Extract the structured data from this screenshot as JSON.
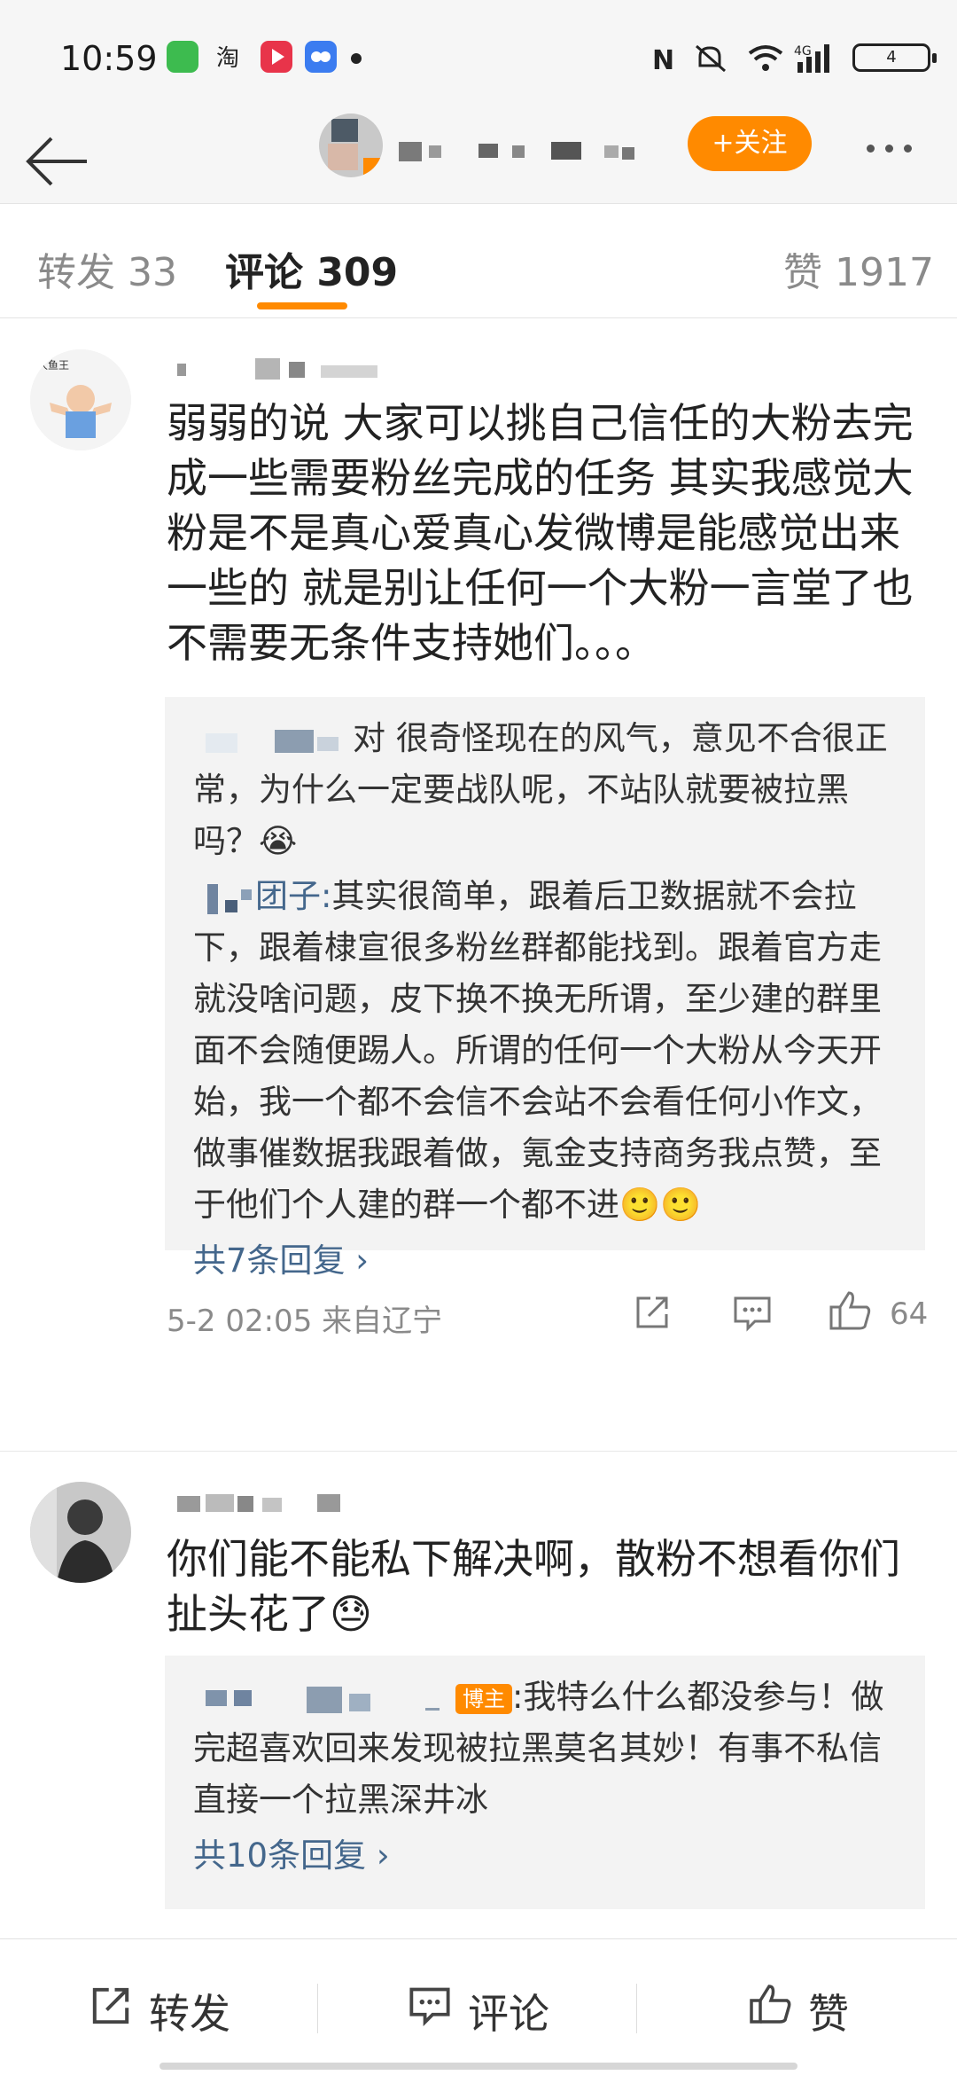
{
  "status_bar": {
    "time": "10:59",
    "battery": "4",
    "network": "4G",
    "app_icons": [
      "wechat-like-icon",
      "taobao-icon",
      "video-icon",
      "bubble-icon"
    ]
  },
  "header": {
    "follow_label": "+关注"
  },
  "tabs": {
    "repost": "转发 33",
    "comments": "评论 309",
    "likes": "赞 1917"
  },
  "comments": [
    {
      "text": "弱弱的说 大家可以挑自己信任的大粉去完成一些需要粉丝完成的任务 其实我感觉大粉是不是真心爱真心发微博是能感觉出来一些的 就是别让任何一个大粉一言堂了也不需要无条件支持她们。。。",
      "replies": [
        {
          "name": "",
          "text": "对 很奇怪现在的风气，意见不合很正常，为什么一定要战队呢，不站队就要被拉黑吗？😭"
        },
        {
          "name": "团子:",
          "text": "其实很简单，跟着后卫数据就不会拉下，跟着棣宣很多粉丝群都能找到。跟着官方走就没啥问题，皮下换不换无所谓，至少建的群里面不会随便踢人。所谓的任何一个大粉从今天开始，我一个都不会信不会站不会看任何小作文，做事催数据我跟着做，氪金支持商务我点赞，至于他们个人建的群一个都不进🙂🙂"
        }
      ],
      "more_replies": "共7条回复 ›",
      "time_location": "5-2 02:05 来自辽宁",
      "likes": "64"
    },
    {
      "text": "你们能不能私下解决啊，散粉不想看你们扯头花了😓",
      "replies": [
        {
          "badge": "博主",
          "text": ":我特么什么都没参与！做完超喜欢回来发现被拉黑莫名其妙！有事不私信直接一个拉黑深井冰"
        }
      ],
      "more_replies": "共10条回复 ›"
    }
  ],
  "bottom_bar": {
    "repost": "转发",
    "comment": "评论",
    "like": "赞"
  },
  "colors": {
    "accent": "#ff8a00",
    "link": "#44678c",
    "muted": "#8a8a8a"
  }
}
